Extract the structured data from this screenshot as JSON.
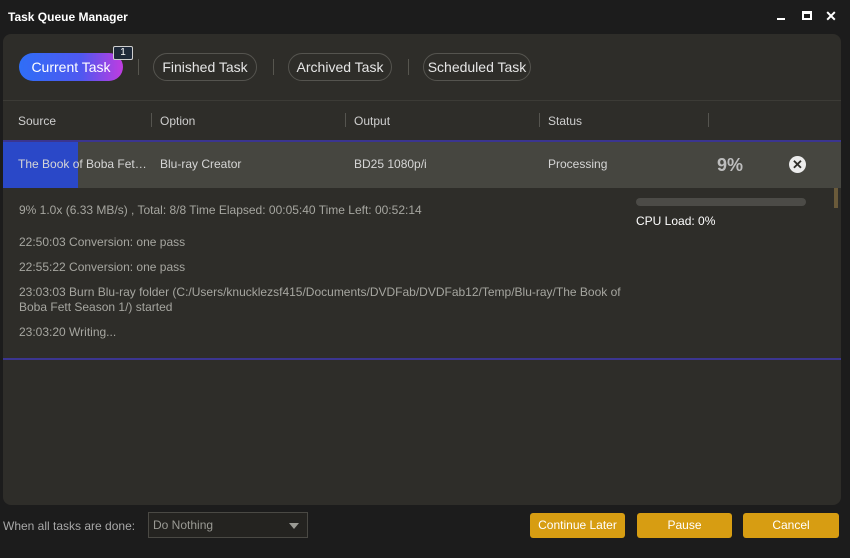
{
  "window": {
    "title": "Task Queue Manager",
    "minimize_icon": "minimize-icon",
    "maximize_icon": "maximize-icon",
    "close_glyph": "✕"
  },
  "tabs": [
    {
      "label": "Current Task",
      "badge": "1",
      "active": true
    },
    {
      "label": "Finished Task"
    },
    {
      "label": "Archived Task"
    },
    {
      "label": "Scheduled Task"
    }
  ],
  "columns": [
    "Source",
    "Option",
    "Output",
    "Status"
  ],
  "task": {
    "source": "The Book of Boba Fett Season 1",
    "option": "Blu-ray Creator",
    "output": "BD25 1080p/i",
    "status": "Processing",
    "percent": "9%",
    "progress_fraction": 0.09,
    "remove_glyph": "✕"
  },
  "detail": {
    "stats": "9%  1.0x (6.33 MB/s) ,  Total: 8/8  Time Elapsed: 00:05:40  Time Left: 00:52:14",
    "log": [
      "22:50:03  Conversion: one pass",
      "22:55:22  Conversion: one pass",
      "23:03:03  Burn Blu-ray folder (C:/Users/knucklezsf415/Documents/DVDFab/DVDFab12/Temp/Blu-ray/The Book of Boba Fett Season 1/) started",
      "23:03:20  Writing..."
    ],
    "cpu_load": "CPU Load: 0%",
    "cpu_fraction": 0
  },
  "footer": {
    "label": "When all tasks are done:",
    "select_value": "Do Nothing",
    "continue_later": "Continue Later",
    "pause": "Pause",
    "cancel": "Cancel"
  },
  "colors": {
    "accent": "#d79d12",
    "progress": "#2a48c8",
    "tab_gradient_start": "#2f6ef7",
    "tab_gradient_end": "#c03ce0"
  }
}
